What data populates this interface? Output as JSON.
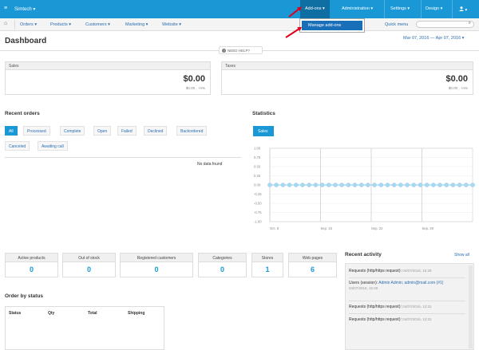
{
  "topbar": {
    "brand": "Simtech ▾",
    "menu": [
      "Add-ons ▾",
      "Administration ▾",
      "Settings ▾",
      "Design ▾"
    ],
    "user_icon": "user-icon ▾"
  },
  "dropdown": {
    "item": "Manage add-ons"
  },
  "subnav": {
    "items": [
      "Orders ▾",
      "Products ▾",
      "Customers ▾",
      "Marketing ▾",
      "Website ▾"
    ],
    "quick_menu": "Quick menu"
  },
  "page": {
    "title": "Dashboard",
    "date_range": "Mar 07, 2016 — Apr 07, 2016 ▾",
    "need_help": "NEED HELP?"
  },
  "sales": {
    "label": "Sales",
    "amount": "$0.00",
    "sub": "$0.00 , +n%"
  },
  "taxes": {
    "label": "Taxes",
    "amount": "$0.00",
    "sub": "$0.00 , +n%"
  },
  "recent_orders": {
    "title": "Recent orders",
    "tabs": [
      "All",
      "Processed",
      "Complete",
      "Open",
      "Failed",
      "Declined",
      "Backordered",
      "Canceled",
      "Awaiting call"
    ],
    "no_data": "No data found"
  },
  "statistics": {
    "title": "Statistics",
    "button": "Sales"
  },
  "chart_data": {
    "type": "line",
    "title": "",
    "xlabel": "",
    "ylabel": "",
    "x_ticks": [
      "Oct. 8",
      "Sep. 15",
      "Sep. 22",
      "Sep. 29"
    ],
    "y_ticks": [
      "1.00",
      "0.75",
      "0.50",
      "0.25",
      "0.00",
      "-0.25",
      "-0.50",
      "-0.75",
      "-1.00"
    ],
    "ylim": [
      -1,
      1
    ],
    "series": [
      {
        "values": [
          0,
          0,
          0,
          0,
          0,
          0,
          0,
          0,
          0,
          0,
          0,
          0,
          0,
          0,
          0,
          0,
          0,
          0,
          0,
          0,
          0,
          0,
          0,
          0,
          0,
          0,
          0,
          0,
          0,
          0,
          0,
          0
        ]
      }
    ],
    "grid": true
  },
  "stats": [
    {
      "label": "Active products",
      "value": "0"
    },
    {
      "label": "Out of stock",
      "value": "0"
    },
    {
      "label": "Registered customers",
      "value": "0"
    },
    {
      "label": "Categories",
      "value": "0"
    },
    {
      "label": "Stores",
      "value": "1"
    },
    {
      "label": "Web pages",
      "value": "6"
    }
  ],
  "recent_activity": {
    "title": "Recent activity",
    "show_all": "Show all",
    "items": [
      {
        "text": "Requests (http/https request): ",
        "link": "",
        "time": "04/07/2016, 15:28"
      },
      {
        "text": "Users (session): ",
        "link": "Admin Admin; admin@mail.com (#1)",
        "time": "04/07/2016, 15:28"
      },
      {
        "text": "Requests (http/https request): ",
        "link": "",
        "time": "04/07/2016, 12:22"
      },
      {
        "text": "Requests (http/https request): ",
        "link": "",
        "time": "04/07/2016, 12:22"
      }
    ]
  },
  "order_by_status": {
    "title": "Order by status",
    "columns": [
      "Status",
      "Qty",
      "Total",
      "Shipping"
    ]
  }
}
